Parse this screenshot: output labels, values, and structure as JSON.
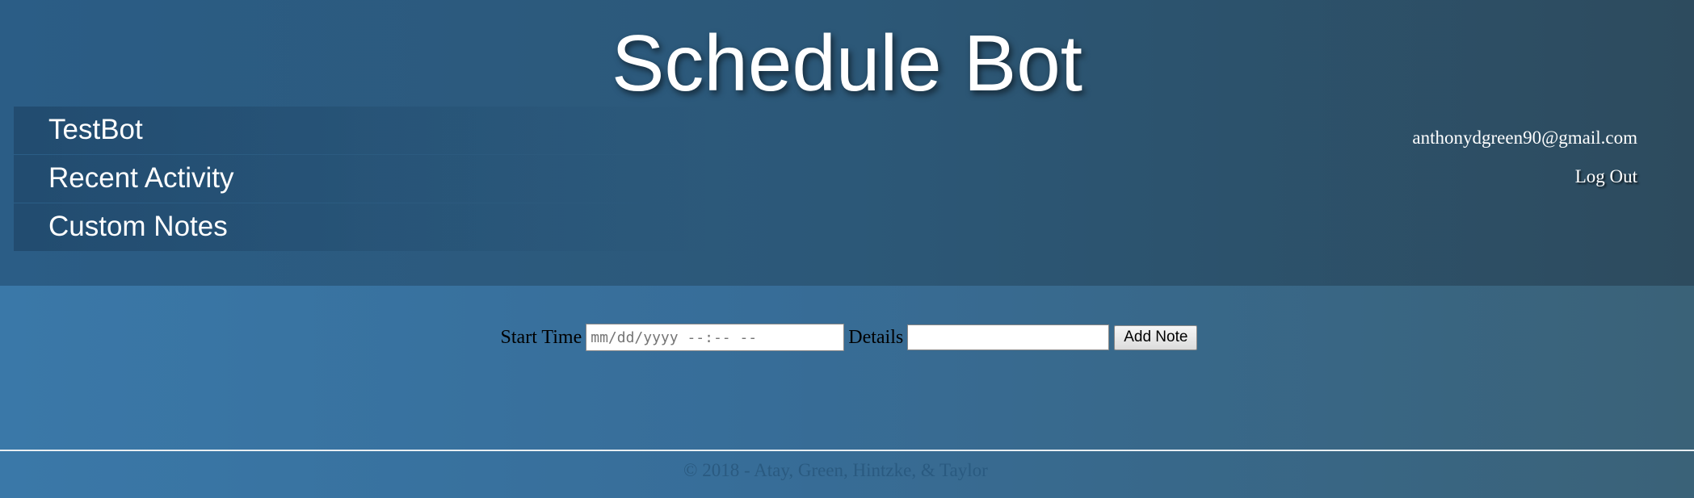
{
  "header": {
    "title": "Schedule Bot"
  },
  "nav": {
    "items": [
      {
        "label": "TestBot"
      },
      {
        "label": "Recent Activity"
      },
      {
        "label": "Custom Notes"
      }
    ]
  },
  "user": {
    "email": "anthonydgreen90@gmail.com",
    "logout_label": "Log Out"
  },
  "form": {
    "start_time_label": "Start Time",
    "start_time_placeholder": "mm/dd/yyyy --:-- --",
    "start_time_value": "",
    "details_label": "Details",
    "details_value": "",
    "add_button_label": "Add Note"
  },
  "footer": {
    "copyright": "© 2018 - Atay, Green, Hintzke, & Taylor"
  }
}
